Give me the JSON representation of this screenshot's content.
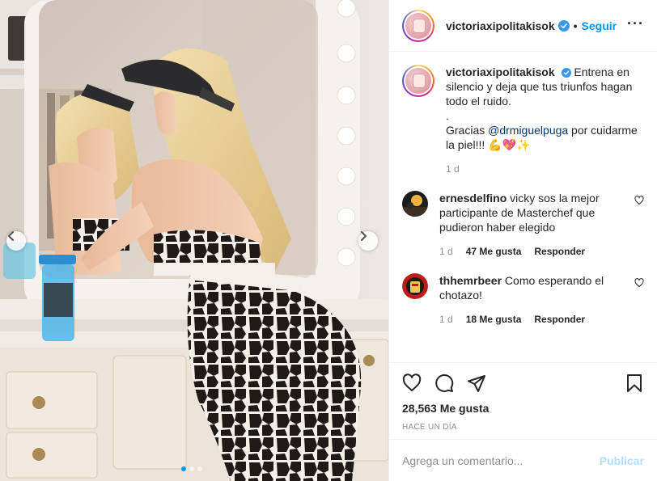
{
  "colors": {
    "accent": "#0095f6",
    "text": "#262626",
    "muted": "#8e8e8e",
    "border": "#efefef",
    "post_disabled": "#b2dffc",
    "mention": "#00376b"
  },
  "header": {
    "username": "victoriaxipolitakisok",
    "separator": "•",
    "follow_label": "Seguir",
    "more_label": "···"
  },
  "caption": {
    "username": "victoriaxipolitakisok",
    "line1": "Entrena en silencio y deja que tus triunfos hagan todo el ruido.",
    "dot": ".",
    "thanks_prefix": "Gracias ",
    "mention": "@drmiguelpuga",
    "thanks_suffix": " por cuidarme la piel!!! 💪💖✨",
    "age": "1 d"
  },
  "comments": [
    {
      "username": "ernesdelfino",
      "text": "vicky sos la mejor participante de Masterchef que pudieron haber elegido",
      "age": "1 d",
      "likes": "47 Me gusta",
      "reply": "Responder"
    },
    {
      "username": "thhemrbeer",
      "text": "Como esperando el chotazo!",
      "age": "1 d",
      "likes": "18 Me gusta",
      "reply": "Responder"
    }
  ],
  "actions": {
    "likes_count": "28,563 Me gusta",
    "timestamp": "HACE UN DÍA",
    "icons": [
      "heart-icon",
      "comment-icon",
      "share-icon",
      "bookmark-icon"
    ]
  },
  "add_comment": {
    "placeholder": "Agrega un comentario...",
    "post_label": "Publicar"
  },
  "carousel": {
    "slides": 3,
    "active_index": 0
  }
}
